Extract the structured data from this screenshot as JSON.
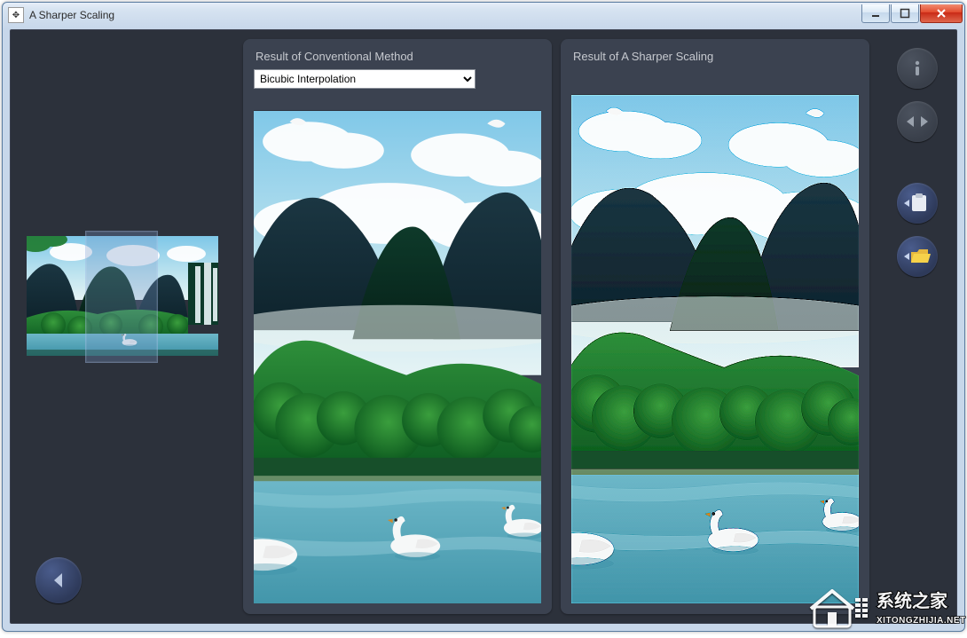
{
  "window": {
    "title": "A Sharper Scaling"
  },
  "panel_left": {
    "title": "Result of Conventional Method",
    "selected_method": "Bicubic Interpolation",
    "methods": [
      "Bicubic Interpolation"
    ]
  },
  "panel_right": {
    "title": "Result of  A Sharper Scaling"
  },
  "icons": {
    "info": "info-icon",
    "compare": "compare-arrows-icon",
    "copy_clipboard": "copy-to-clipboard-icon",
    "open_folder": "open-folder-icon",
    "back": "back-arrow-icon",
    "app": "scale-app-icon",
    "minimize": "minimize-icon",
    "maximize": "maximize-icon",
    "close": "close-icon"
  },
  "watermark": {
    "line1": "系统之家",
    "line2": "XITONGZHIJIA.NET"
  }
}
